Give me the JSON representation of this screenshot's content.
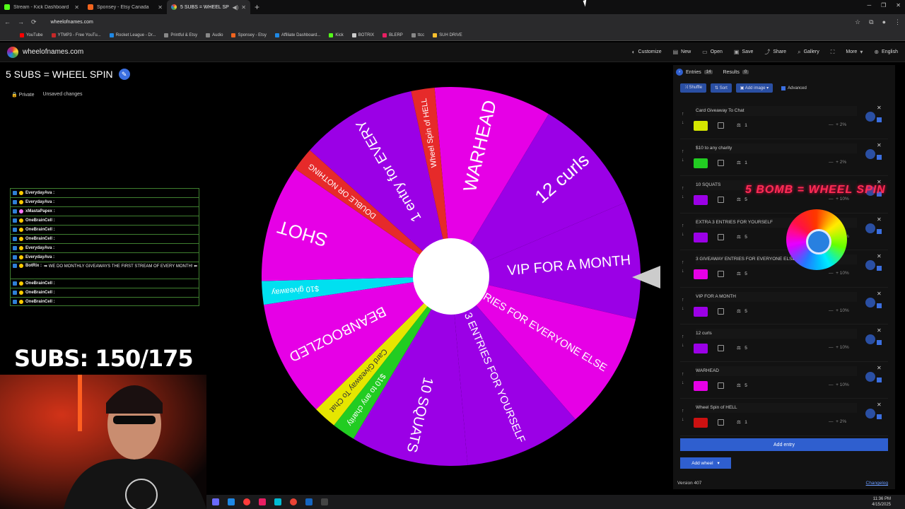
{
  "browser": {
    "tabs": [
      {
        "title": "Stream - Kick Dashboard",
        "color": "#53fc18"
      },
      {
        "title": "Sponsey - Etsy Canada",
        "color": "#f1641e"
      },
      {
        "title": "5 SUBS = WHEEL SPIN",
        "color": "#e53935"
      }
    ],
    "url": "wheelofnames.com",
    "bookmarks": [
      {
        "label": "YouTube",
        "color": "#ff0000"
      },
      {
        "label": "YTMP3 - Free YouTu...",
        "color": "#c62828"
      },
      {
        "label": "Rocket League - Dr...",
        "color": "#1e88e5"
      },
      {
        "label": "Printful & Etsy",
        "color": "#888888"
      },
      {
        "label": "Audio",
        "color": "#888888"
      },
      {
        "label": "Sponsey - Etsy",
        "color": "#f1641e"
      },
      {
        "label": "Affiliate Dashboard...",
        "color": "#1e88e5"
      },
      {
        "label": "Kick",
        "color": "#53fc18"
      },
      {
        "label": "BOTRIX",
        "color": "#cccccc"
      },
      {
        "label": "BLERP",
        "color": "#e91e63"
      },
      {
        "label": "ttcc",
        "color": "#888888"
      },
      {
        "label": "SUH DRIVE",
        "color": "#fbc02d"
      }
    ]
  },
  "site": {
    "name": "wheelofnames.com",
    "menu": [
      "Customize",
      "New",
      "Open",
      "Save",
      "Share",
      "Gallery",
      "More",
      "English"
    ]
  },
  "wheel_title": "5 SUBS = WHEEL SPIN",
  "meta": {
    "private": "Private",
    "unsaved": "Unsaved changes"
  },
  "chat": [
    {
      "user": "EverydayAva :",
      "msg": "",
      "color": "#ffcc00"
    },
    {
      "user": "EverydayAva :",
      "msg": "",
      "color": "#ffcc00"
    },
    {
      "user": "xMastaPapex :",
      "msg": "",
      "color": "#ff77ff"
    },
    {
      "user": "OneBrainCell :",
      "msg": "",
      "color": "#ffcc00"
    },
    {
      "user": "OneBrainCell :",
      "msg": "",
      "color": "#ffcc00"
    },
    {
      "user": "OneBrainCell :",
      "msg": "",
      "color": "#ffcc00"
    },
    {
      "user": "EverydayAva :",
      "msg": "",
      "color": "#ffcc00"
    },
    {
      "user": "EverydayAva :",
      "msg": "",
      "color": "#ffcc00"
    },
    {
      "user": "BotRix :",
      "msg": "➡ WE DO MONTHLY GIVEAWAYS THE FIRST STREAM OF EVERY MONTH! ⬅",
      "color": "#ffcc00"
    },
    {
      "user": "OneBrainCell :",
      "msg": "",
      "color": "#ffcc00"
    },
    {
      "user": "OneBrainCell :",
      "msg": "",
      "color": "#ffcc00"
    },
    {
      "user": "OneBrainCell :",
      "msg": "",
      "color": "#ffcc00"
    }
  ],
  "subs_overlay": "SUBS: 150/175",
  "wheel": {
    "segments": [
      {
        "label": "WARHEAD",
        "color": "#e600e6",
        "weight": 5
      },
      {
        "label": "12 curls",
        "color": "#9b00e6",
        "weight": 5
      },
      {
        "label": "VIP FOR A MONTH",
        "color": "#9b00e6",
        "weight": 5
      },
      {
        "label": "3 GIVEAWAY ENTRIES FOR EVERYONE ELSE",
        "color": "#e600e6",
        "weight": 5
      },
      {
        "label": "EXTRA 3 ENTRIES FOR YOURSELF",
        "color": "#9b00e6",
        "weight": 5
      },
      {
        "label": "10 SQUATS",
        "color": "#9b00e6",
        "weight": 5
      },
      {
        "label": "$10 to any charity",
        "color": "#22cc22",
        "weight": 1
      },
      {
        "label": "Card Giveaway To Chat",
        "color": "#e6e600",
        "weight": 1
      },
      {
        "label": "BEANBOOZLED",
        "color": "#e600e6",
        "weight": 5
      },
      {
        "label": "$10 giveaway",
        "color": "#00e0f0",
        "weight": 1
      },
      {
        "label": "SHOT",
        "color": "#e600e6",
        "weight": 5
      },
      {
        "label": "DOUBLE OR NOTHING",
        "color": "#e62a2a",
        "weight": 1
      },
      {
        "label": "1 entry for EVERY",
        "color": "#9b00e6",
        "weight": 5
      },
      {
        "label": "Wheel Spin of HELL",
        "color": "#e62a2a",
        "weight": 1
      }
    ]
  },
  "panel": {
    "entries_tab": "Entries",
    "entries_count": "14",
    "results_tab": "Results",
    "results_count": "0",
    "tools": {
      "shuffle": "Shuffle",
      "sort": "Sort",
      "add_image": "Add image",
      "advanced": "Advanced"
    },
    "entries": [
      {
        "name": "Card Giveaway To Chat",
        "color": "#d4e600",
        "weight": "1",
        "pct": "2%"
      },
      {
        "name": "$10 to any charity",
        "color": "#22cc22",
        "weight": "1",
        "pct": "2%"
      },
      {
        "name": "10 SQUATS",
        "color": "#9b00e6",
        "weight": "5",
        "pct": "10%"
      },
      {
        "name": "EXTRA 3 ENTRIES FOR YOURSELF",
        "color": "#9b00e6",
        "weight": "5",
        "pct": "10%"
      },
      {
        "name": "3 GIVEAWAY ENTRIES FOR EVERYONE ELSE",
        "color": "#e600e6",
        "weight": "5",
        "pct": "10%"
      },
      {
        "name": "VIP FOR A MONTH",
        "color": "#9b00e6",
        "weight": "5",
        "pct": "10%"
      },
      {
        "name": "12 curls",
        "color": "#9b00e6",
        "weight": "5",
        "pct": "10%"
      },
      {
        "name": "WARHEAD",
        "color": "#e600e6",
        "weight": "5",
        "pct": "10%"
      },
      {
        "name": "Wheel Spin of HELL",
        "color": "#cc1111",
        "weight": "1",
        "pct": "2%"
      }
    ],
    "add_entry": "Add entry",
    "add_wheel": "Add wheel",
    "version": "Version 407",
    "changelog": "Changelog"
  },
  "overlay_banner": "5 BOMB = WHEEL SPIN",
  "clock": {
    "time": "11:36 PM",
    "date": "4/15/2025"
  }
}
